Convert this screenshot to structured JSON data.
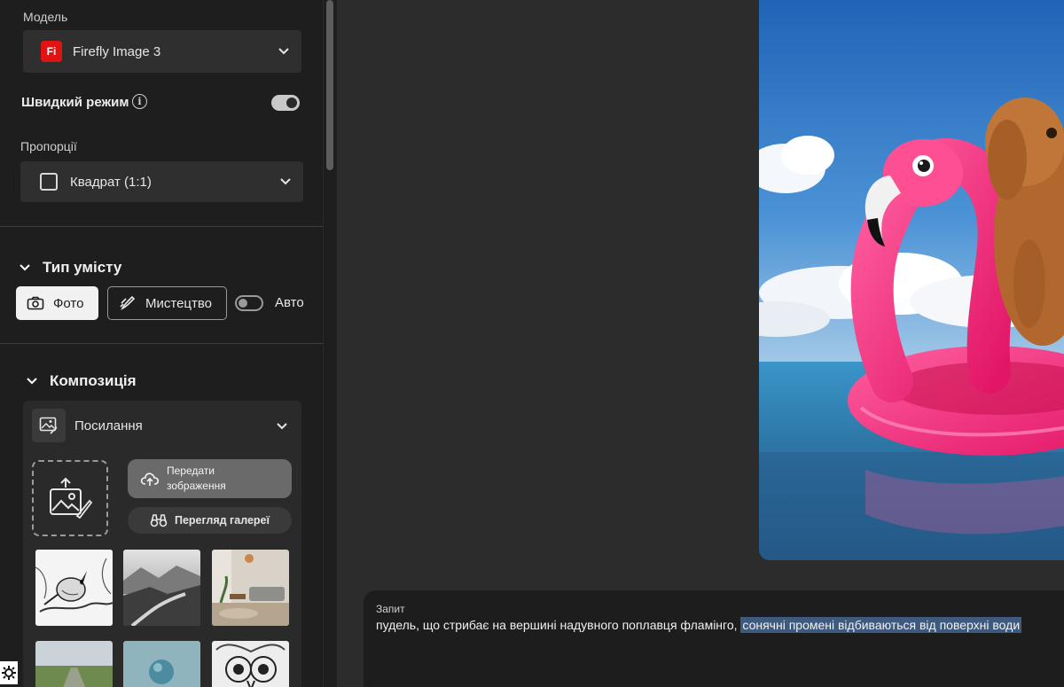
{
  "sidebar": {
    "model_label": "Модель",
    "model_badge": "Fi",
    "model_value": "Firefly Image 3",
    "fast_mode_label": "Швидкий режим",
    "fast_mode_on": true,
    "aspect_label": "Пропорції",
    "aspect_value": "Квадрат (1:1)",
    "content_type": {
      "title": "Тип умісту",
      "photo_label": "Фото",
      "art_label": "Мистецтво",
      "auto_label": "Авто",
      "auto_on": false
    },
    "composition": {
      "title": "Композиція",
      "reference_title": "Посилання",
      "upload_label": "Передати зображення",
      "gallery_label": "Перегляд галереї"
    }
  },
  "prompt": {
    "label": "Запит",
    "text_plain": "пудель, що стрибає на вершині надувного поплавця фламінго, ",
    "text_selected": "сонячні промені відбиваються від поверхні води"
  },
  "colors": {
    "accent_badge": "#e21313",
    "selection": "#3e5a7e"
  }
}
